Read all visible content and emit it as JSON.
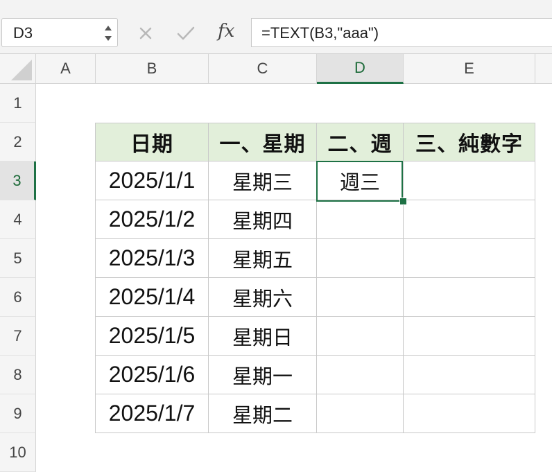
{
  "name_box": {
    "value": "D3"
  },
  "formula_bar": {
    "cancel_icon": "x-icon",
    "confirm_icon": "check-icon",
    "fx_label": "fx",
    "formula": "=TEXT(B3,\"aaa\")"
  },
  "columns": [
    "A",
    "B",
    "C",
    "D",
    "E"
  ],
  "rows": [
    "1",
    "2",
    "3",
    "4",
    "5",
    "6",
    "7",
    "8",
    "9",
    "10"
  ],
  "active_cell": {
    "column": "D",
    "row": "3"
  },
  "table": {
    "headers": [
      "日期",
      "一、星期",
      "二、週",
      "三、純數字"
    ],
    "rows": [
      {
        "date": "2025/1/1",
        "weekday_full": "星期三",
        "weekday_short": "週三",
        "number": ""
      },
      {
        "date": "2025/1/2",
        "weekday_full": "星期四",
        "weekday_short": "",
        "number": ""
      },
      {
        "date": "2025/1/3",
        "weekday_full": "星期五",
        "weekday_short": "",
        "number": ""
      },
      {
        "date": "2025/1/4",
        "weekday_full": "星期六",
        "weekday_short": "",
        "number": ""
      },
      {
        "date": "2025/1/5",
        "weekday_full": "星期日",
        "weekday_short": "",
        "number": ""
      },
      {
        "date": "2025/1/6",
        "weekday_full": "星期一",
        "weekday_short": "",
        "number": ""
      },
      {
        "date": "2025/1/7",
        "weekday_full": "星期二",
        "weekday_short": "",
        "number": ""
      }
    ]
  },
  "colors": {
    "header_fill": "#e2efda",
    "selection": "#1e7145",
    "active_header_text": "#1e6b3a"
  }
}
